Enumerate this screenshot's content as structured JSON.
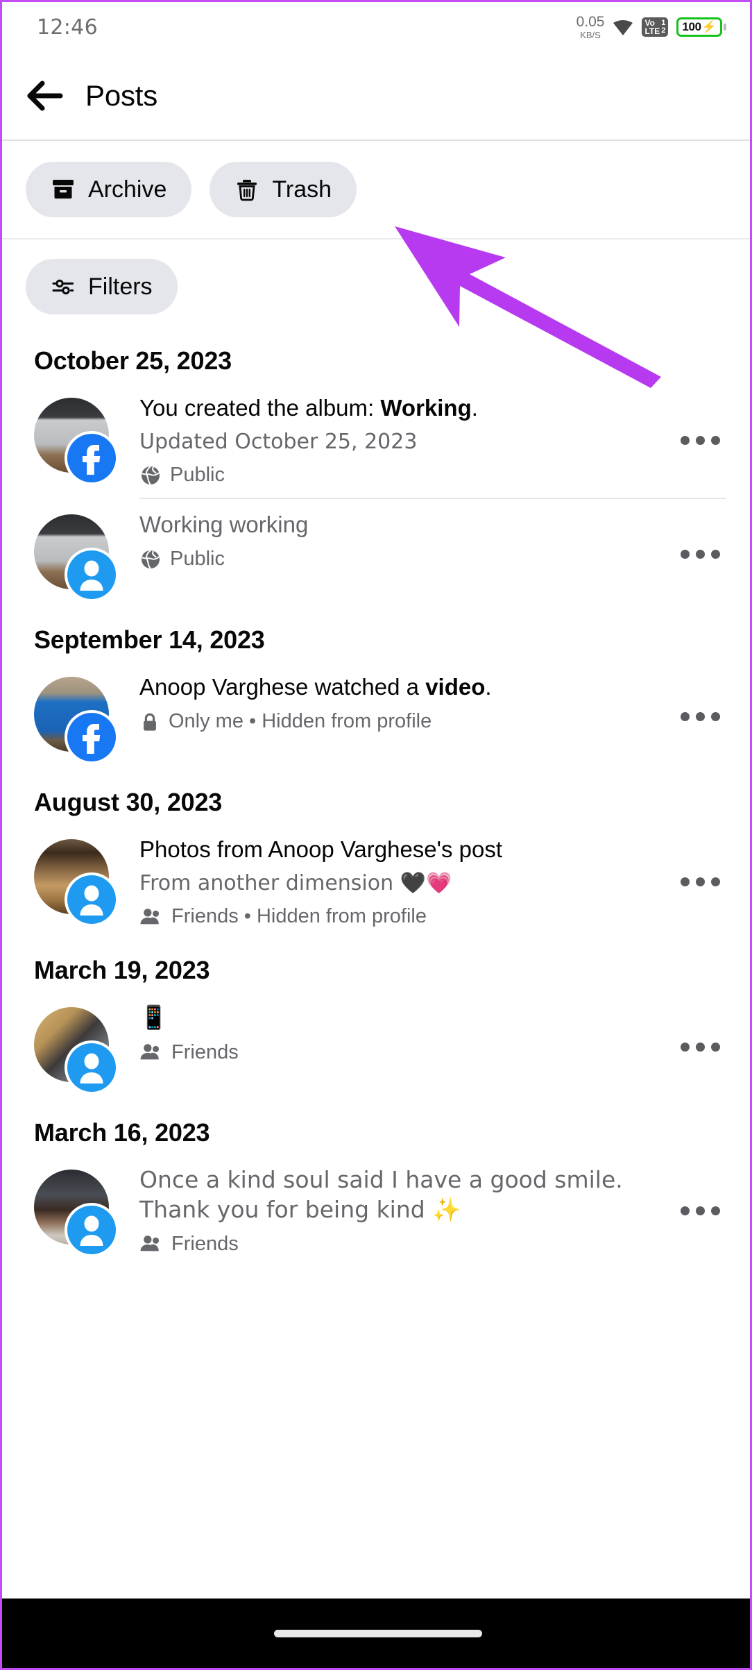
{
  "status_bar": {
    "time": "12:46",
    "net_speed_value": "0.05",
    "net_speed_unit": "KB/S",
    "wifi_icon": "wifi-icon",
    "volte_label_top": "Vo",
    "volte_label_bottom": "LTE",
    "volte_sim1": "1",
    "volte_sim2": "2",
    "battery_percent": "100",
    "battery_charging_icon": "bolt-icon",
    "battery_color": "#14c21b"
  },
  "app_bar": {
    "back_icon": "back-arrow-icon",
    "title": "Posts"
  },
  "chips": {
    "archive": {
      "label": "Archive",
      "icon": "archive-box-icon"
    },
    "trash": {
      "label": "Trash",
      "icon": "trash-can-icon"
    },
    "filters": {
      "label": "Filters",
      "icon": "sliders-tune-icon"
    }
  },
  "annotation": {
    "arrow_color": "#b73af0",
    "points_to": "Trash"
  },
  "feed": [
    {
      "date": "October 25, 2023",
      "posts": [
        {
          "title_prefix": "You created the album: ",
          "title_bold": "Working",
          "title_suffix": ".",
          "subtitle": "Updated October 25, 2023",
          "privacy_icon": "globe-icon",
          "privacy": "Public",
          "badge": "facebook-badge",
          "thumb": "keyboard-photo",
          "menu": "more-options",
          "divider": true
        },
        {
          "title_prefix": "Working working",
          "title_bold": "",
          "title_suffix": "",
          "title_muted": true,
          "subtitle": "",
          "privacy_icon": "globe-icon",
          "privacy": "Public",
          "badge": "profile-badge",
          "thumb": "keyboard-photo",
          "menu": "more-options",
          "divider": false
        }
      ]
    },
    {
      "date": "September 14, 2023",
      "posts": [
        {
          "title_prefix": "Anoop Varghese watched a ",
          "title_bold": "video",
          "title_suffix": ".",
          "subtitle": "",
          "privacy_icon": "lock-icon",
          "privacy": "Only me • Hidden from profile",
          "badge": "facebook-badge",
          "thumb": "rickshaw-photo",
          "menu": "more-options",
          "divider": false
        }
      ]
    },
    {
      "date": "August 30, 2023",
      "posts": [
        {
          "title_prefix": "Photos from Anoop Varghese's post",
          "title_bold": "",
          "title_suffix": "",
          "subtitle": "From another dimension 🖤💗",
          "privacy_icon": "friends-icon",
          "privacy": "Friends • Hidden from profile",
          "badge": "profile-badge",
          "thumb": "bottles-photo",
          "menu": "more-options",
          "divider": false
        }
      ]
    },
    {
      "date": "March 19, 2023",
      "posts": [
        {
          "title_prefix": "📱",
          "title_bold": "",
          "title_suffix": "",
          "subtitle": "",
          "privacy_icon": "friends-icon",
          "privacy": "Friends",
          "badge": "profile-badge",
          "thumb": "mirror-selfie-photo",
          "menu": "more-options",
          "divider": false
        }
      ]
    },
    {
      "date": "March 16, 2023",
      "posts": [
        {
          "title_prefix": "Once a kind soul said I have a good smile. Thank you for being kind ✨",
          "title_bold": "",
          "title_suffix": "",
          "title_muted": true,
          "subtitle": "",
          "privacy_icon": "friends-icon",
          "privacy": "Friends",
          "badge": "profile-badge",
          "thumb": "portrait-photo",
          "menu": "more-options",
          "divider": false
        }
      ]
    }
  ],
  "nav_bar": {
    "home_indicator": "home-indicator-pill"
  }
}
